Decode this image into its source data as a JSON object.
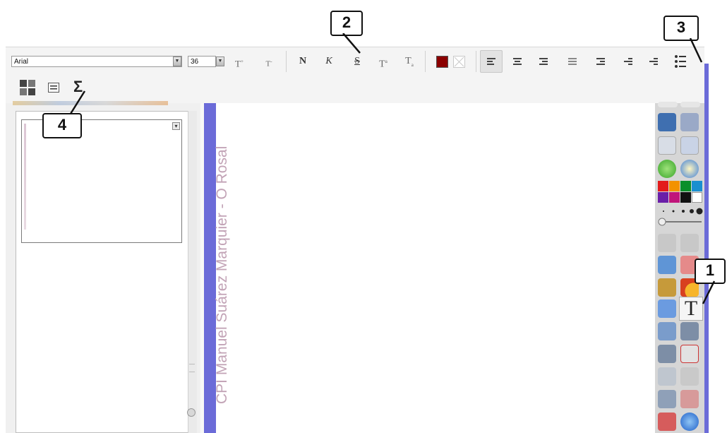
{
  "toolbar": {
    "font_family": "Arial",
    "font_size": "36",
    "grow_label": "T",
    "shrink_label": "T",
    "bold_label": "N",
    "italic_label": "K",
    "strike_label": "S",
    "superscript_label": "T",
    "subscript_label": "T",
    "text_color": "#8b0000",
    "equation_label": "Σ"
  },
  "callouts": {
    "c1": "1",
    "c2": "2",
    "c3": "3",
    "c4": "4"
  },
  "canvas": {
    "margin_text": "CPI Manuel Suárez Marquier - O Rosal"
  },
  "palette": {
    "text_tool_label": "T",
    "swatches": [
      "#e31b1b",
      "#f39200",
      "#0a8f2a",
      "#1a8fd0",
      "#6a1fa8",
      "#c0157a",
      "#111111",
      "#ffffff"
    ]
  }
}
